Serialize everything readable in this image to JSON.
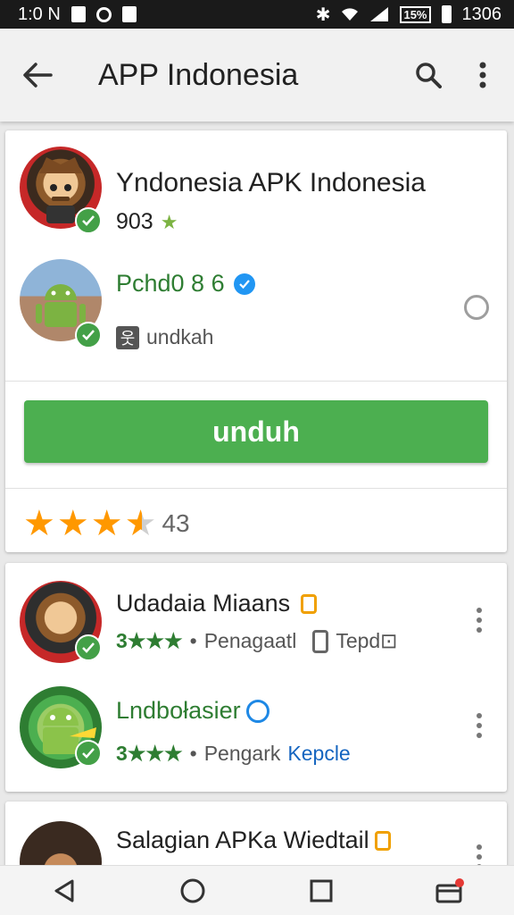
{
  "status": {
    "time": "1:0 N",
    "right_time": "1306",
    "battery": "15%"
  },
  "appbar": {
    "title": "APP Indonesia"
  },
  "main_card": {
    "app_title": "Yndonesia APK Indonesia",
    "rating_count": "903",
    "developer": "Pchd0 8 6",
    "developer_sub": "undkah",
    "install_label": "unduh",
    "stars_count": "43",
    "stars_value": 3.5
  },
  "list": [
    {
      "title": "Udadaia Miaans",
      "rating": "3★★★",
      "sep": "•",
      "meta": "Penagaatl",
      "extra": "Tepd⊡"
    },
    {
      "title": "Lndbołasier",
      "rating": "3★★★",
      "sep": "•",
      "meta": "Pengark",
      "extra": "Kepcle"
    },
    {
      "title": "Salagian APKa Wiedtail"
    }
  ],
  "colors": {
    "accent_green": "#4caf50",
    "verified_blue": "#2196f3",
    "star_orange": "#ff9800"
  },
  "icons": [
    "back-arrow-icon",
    "search-icon",
    "more-vert-icon",
    "verified-icon",
    "check-icon",
    "nav-back-icon",
    "nav-home-icon",
    "nav-recents-icon"
  ]
}
